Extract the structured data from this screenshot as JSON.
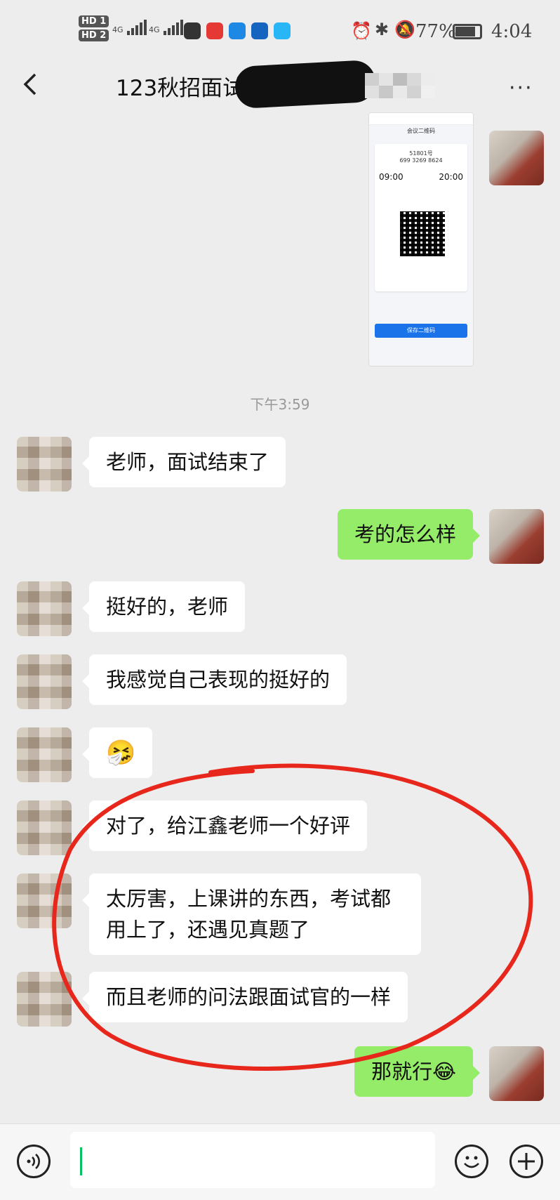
{
  "status_bar": {
    "hd1": "HD 1",
    "hd2": "HD 2",
    "net1": "4G",
    "net2": "4G",
    "battery_percent": "77%",
    "time": "4:04"
  },
  "nav": {
    "title": "123秋招面试",
    "back_icon": "chevron-left-icon",
    "more": "···"
  },
  "messages": [
    {
      "from": "me",
      "type": "image",
      "content": "screenshot of an appointment QR code card"
    },
    {
      "type": "timestamp",
      "text": "下午3:59"
    },
    {
      "from": "other",
      "text": "老师，面试结束了"
    },
    {
      "from": "me",
      "text": "考的怎么样"
    },
    {
      "from": "other",
      "text": "挺好的，老师"
    },
    {
      "from": "other",
      "text": "我感觉自己表现的挺好的"
    },
    {
      "from": "other",
      "text": "🤧",
      "emoji": true
    },
    {
      "from": "other",
      "text": "对了，给江鑫老师一个好评"
    },
    {
      "from": "other",
      "text": "太厉害，上课讲的东西，考试都用上了，还遇见真题了"
    },
    {
      "from": "other",
      "text": "而且老师的问法跟面试官的一样"
    },
    {
      "from": "me",
      "text": "那就行😂"
    }
  ],
  "image_card": {
    "title": "会议二维码",
    "number": "51801号",
    "code": "699 3269 8624",
    "start": "09:00",
    "end": "20:00",
    "button": "保存二维码"
  },
  "input_bar": {
    "voice_icon": "voice-icon",
    "emoji_icon": "smiley-icon",
    "plus_icon": "plus-icon"
  },
  "colors": {
    "my_bubble": "#95ec69",
    "other_bubble": "#ffffff",
    "background": "#ededed",
    "annotation_ring": "#e8271c"
  }
}
